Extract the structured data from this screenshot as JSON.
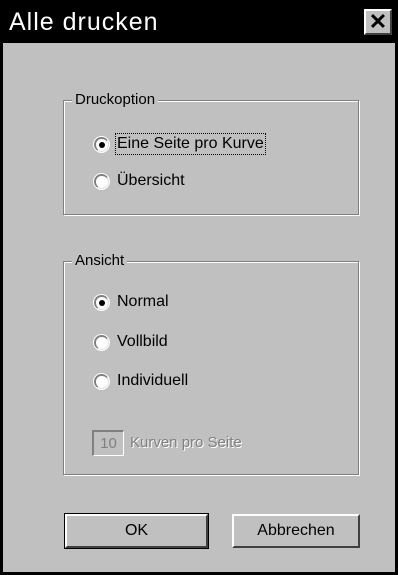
{
  "window": {
    "title": "Alle drucken",
    "close_glyph": "✕"
  },
  "druckoption": {
    "legend": "Druckoption",
    "options": [
      {
        "label": "Eine Seite pro Kurve",
        "checked": true
      },
      {
        "label": "Übersicht",
        "checked": false
      }
    ]
  },
  "ansicht": {
    "legend": "Ansicht",
    "options": [
      {
        "label": "Normal",
        "checked": true
      },
      {
        "label": "Vollbild",
        "checked": false
      },
      {
        "label": "Individuell",
        "checked": false
      }
    ],
    "curves_per_page_value": "10",
    "curves_per_page_label": "Kurven pro Seite"
  },
  "buttons": {
    "ok_label": "OK",
    "cancel_label": "Abbrechen"
  },
  "colors": {
    "dialog_background": "#c0c0c0",
    "titlebar": "#000000",
    "disabled_text": "#808080"
  }
}
